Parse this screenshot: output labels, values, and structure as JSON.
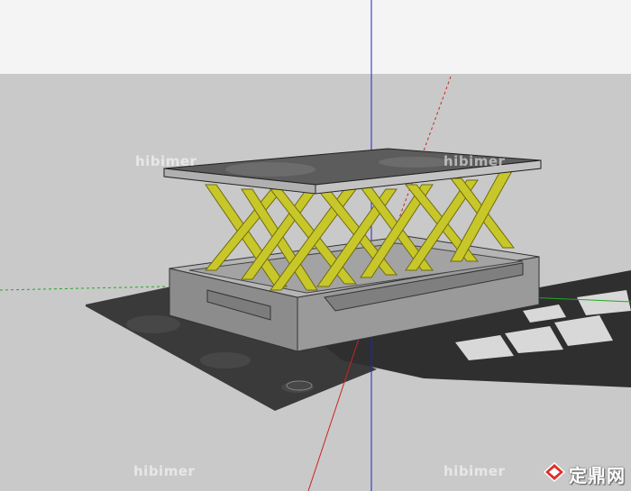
{
  "scene": {
    "sky_color": "#f4f4f4",
    "ground_color": "#c9c9c9",
    "roof_color": "#5c5c5c",
    "lattice_color": "#c8c72a",
    "base_color": "#8f8f8f",
    "shadow_color": "#2e2e2e"
  },
  "axes": {
    "x_color": "#cc2222",
    "y_color": "#22aa22",
    "z_color": "#2222cc"
  },
  "watermarks": [
    {
      "text": "hibimer"
    },
    {
      "text": "hibimer"
    },
    {
      "text": "hibimer"
    },
    {
      "text": "hibimer"
    }
  ],
  "logo": {
    "text": "定鼎网",
    "icon": "diamond-logo-icon"
  }
}
